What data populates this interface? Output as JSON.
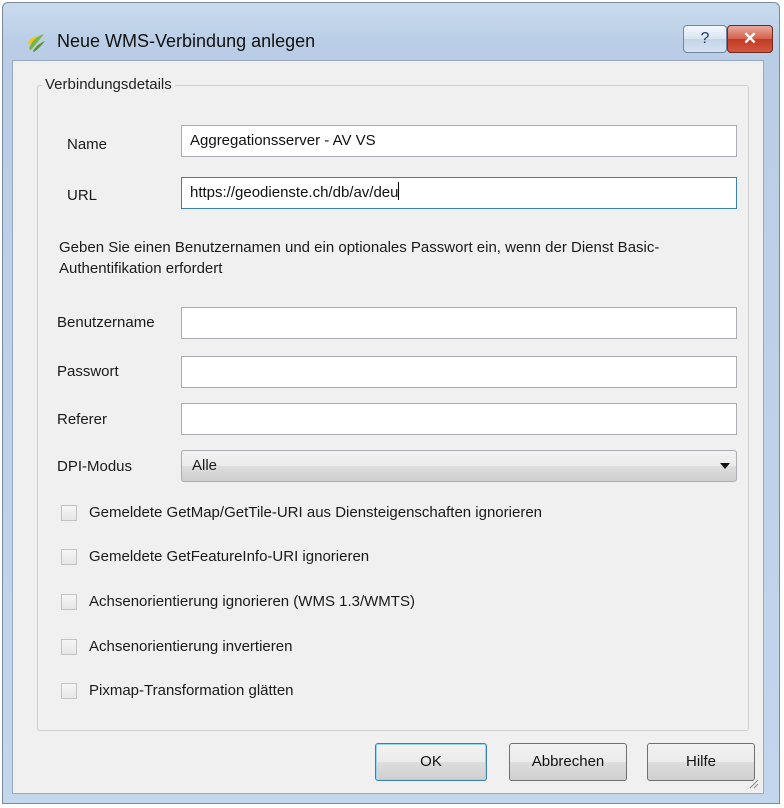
{
  "window": {
    "title": "Neue WMS-Verbindung anlegen",
    "help_label": "?",
    "close_label": "✕"
  },
  "group": {
    "title": "Verbindungsdetails"
  },
  "form": {
    "name_label": "Name",
    "name_value": "Aggregationsserver - AV VS",
    "url_label": "URL",
    "url_value": "https://geodienste.ch/db/av/deu",
    "info_text": "Geben Sie einen Benutzernamen und ein optionales Passwort ein, wenn der Dienst Basic-Authentifikation erfordert",
    "username_label": "Benutzername",
    "username_value": "",
    "password_label": "Passwort",
    "password_value": "",
    "referer_label": "Referer",
    "referer_value": "",
    "dpi_label": "DPI-Modus",
    "dpi_value": "Alle"
  },
  "checkboxes": [
    {
      "label": "Gemeldete GetMap/GetTile-URI aus Diensteigenschaften ignorieren",
      "checked": false
    },
    {
      "label": "Gemeldete GetFeatureInfo-URI ignorieren",
      "checked": false
    },
    {
      "label": "Achsenorientierung ignorieren (WMS 1.3/WMTS)",
      "checked": false
    },
    {
      "label": "Achsenorientierung invertieren",
      "checked": false
    },
    {
      "label": "Pixmap-Transformation glätten",
      "checked": false
    }
  ],
  "buttons": {
    "ok": "OK",
    "cancel": "Abbrechen",
    "help": "Hilfe"
  },
  "icons": {
    "app": "qgis-icon",
    "help": "help-icon",
    "close": "close-icon",
    "dropdown": "chevron-down-icon"
  },
  "colors": {
    "accent": "#3c7fb1",
    "close": "#c23a24",
    "titlebar": "#c2d6ec"
  }
}
